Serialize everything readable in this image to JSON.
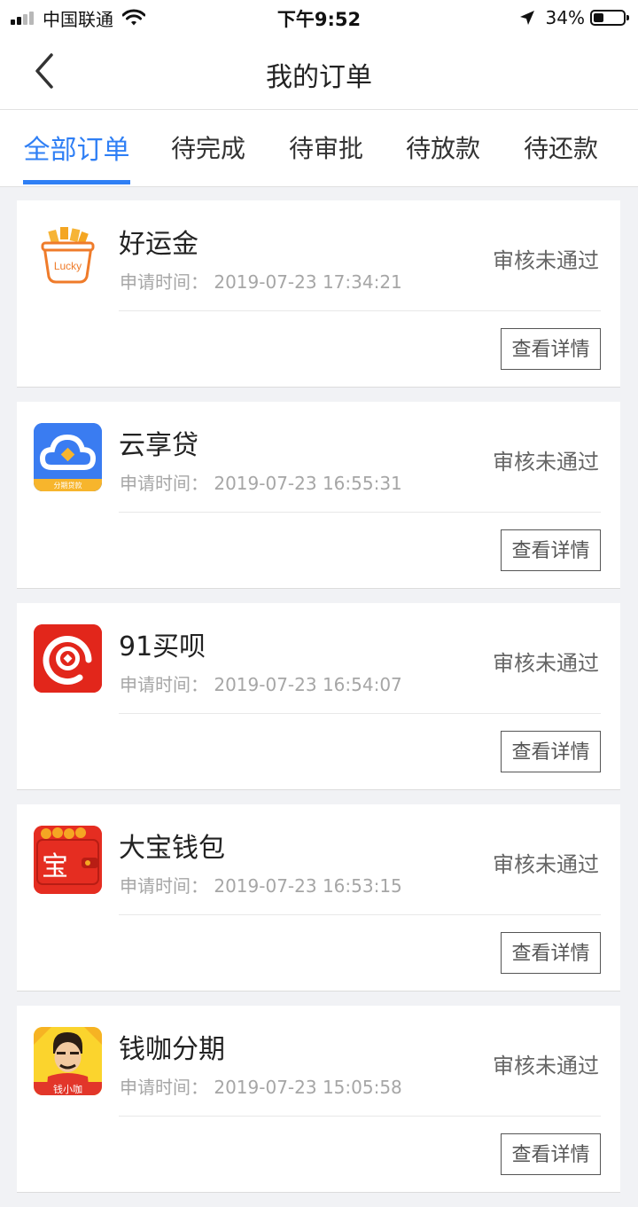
{
  "status_bar": {
    "carrier": "中国联通",
    "time": "下午9:52",
    "battery_percent": "34%",
    "battery_level": 0.34,
    "signal_bars_active": 2,
    "signal_bars_total": 4
  },
  "nav": {
    "title": "我的订单",
    "back_icon": "chevron-left-icon"
  },
  "tabs": [
    {
      "label": "全部订单",
      "active": true
    },
    {
      "label": "待完成",
      "active": false
    },
    {
      "label": "待审批",
      "active": false
    },
    {
      "label": "待放款",
      "active": false
    },
    {
      "label": "待还款",
      "active": false
    }
  ],
  "colors": {
    "accent": "#2f7ff5",
    "background": "#f1f2f5"
  },
  "orders": [
    {
      "name": "好运金",
      "apply_time": "申请时间：  2019-07-23 17:34:21",
      "status": "审核未通过",
      "detail_label": "查看详情",
      "logo_icon": "lucky-bag-logo",
      "logo_text": "Lucky"
    },
    {
      "name": "云享贷",
      "apply_time": "申请时间：  2019-07-23 16:55:31",
      "status": "审核未通过",
      "detail_label": "查看详情",
      "logo_icon": "cloud-logo",
      "logo_text": "分期贷款"
    },
    {
      "name": "91买呗",
      "apply_time": "申请时间：  2019-07-23 16:54:07",
      "status": "审核未通过",
      "detail_label": "查看详情",
      "logo_icon": "red-ring-logo"
    },
    {
      "name": "大宝钱包",
      "apply_time": "申请时间：  2019-07-23 16:53:15",
      "status": "审核未通过",
      "detail_label": "查看详情",
      "logo_icon": "red-wallet-logo",
      "logo_text": "宝"
    },
    {
      "name": "钱咖分期",
      "apply_time": "申请时间：  2019-07-23 15:05:58",
      "status": "审核未通过",
      "detail_label": "查看详情",
      "logo_icon": "cartoon-man-logo",
      "logo_text": "钱小咖"
    }
  ]
}
